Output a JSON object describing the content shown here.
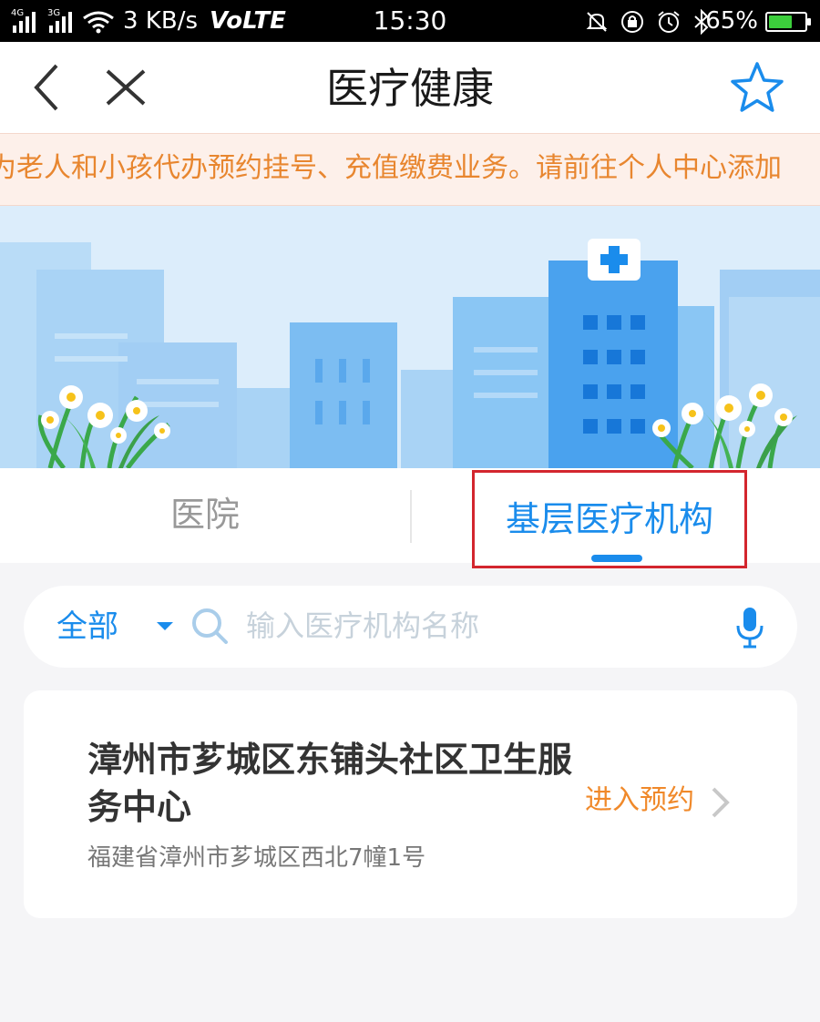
{
  "status_bar": {
    "network_label": "4G",
    "network2_label": "3G",
    "speed": "3 KB/s",
    "volte": "VoLTE",
    "time": "15:30",
    "battery_percent": "65%",
    "battery_level": 0.65,
    "icons": [
      "signal-icon",
      "wifi-icon",
      "mute-icon",
      "rotation-lock-icon",
      "alarm-icon",
      "bluetooth-icon",
      "battery-icon"
    ]
  },
  "header": {
    "title": "医疗健康",
    "back_icon": "back-icon",
    "close_icon": "close-icon",
    "favorite_icon": "star-icon"
  },
  "notice": {
    "text": "为老人和小孩代办预约挂号、充值缴费业务。请前往个人中心添加"
  },
  "tabs": [
    {
      "label": "医院",
      "active": false
    },
    {
      "label": "基层医疗机构",
      "active": true
    }
  ],
  "search": {
    "filter_label": "全部",
    "placeholder": "输入医疗机构名称"
  },
  "institution": {
    "name": "漳州市芗城区东铺头社区卫生服务中心",
    "address": "福建省漳州市芗城区西北7幢1号",
    "action_label": "进入预约"
  },
  "colors": {
    "accent_blue": "#1a8cec",
    "notice_orange": "#e8862f",
    "action_orange": "#f0892a",
    "highlight_red": "#d3262e"
  }
}
